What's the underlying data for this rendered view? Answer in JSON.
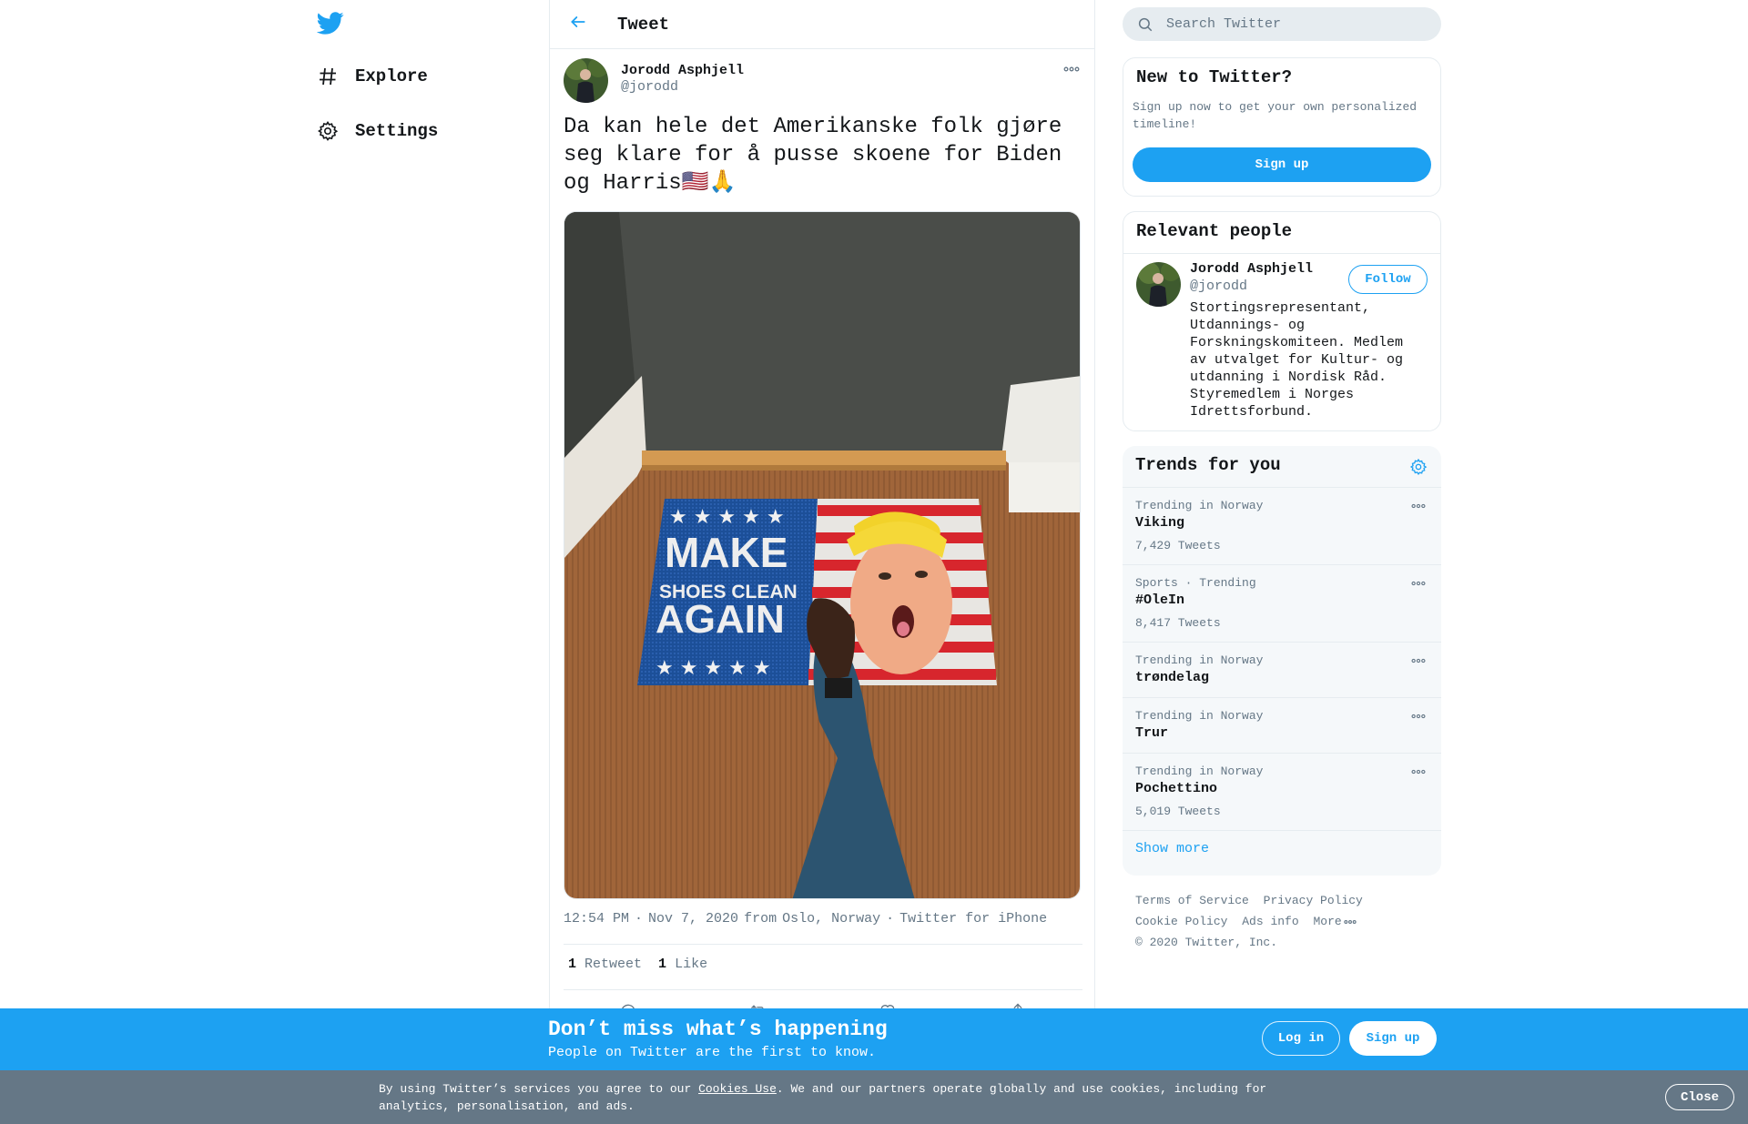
{
  "nav": {
    "logo_icon": "twitter-bird-icon",
    "items": [
      {
        "icon": "hashtag-icon",
        "label": "Explore"
      },
      {
        "icon": "gear-icon",
        "label": "Settings"
      }
    ]
  },
  "header": {
    "back_icon": "arrow-left-icon",
    "title": "Tweet"
  },
  "tweet": {
    "author_name": "Jorodd Asphjell",
    "author_handle": "@jorodd",
    "text": "Da kan hele det Amerikanske folk gjøre seg klare for å pusse skoene for Biden og Harris🇺🇸🙏",
    "media_doormat": {
      "left_top": "MAKE",
      "left_mid": "SHOES CLEAN",
      "left_bottom": "AGAIN"
    },
    "meta": {
      "time": "12:54 PM",
      "sep1": "·",
      "date": "Nov 7, 2020",
      "from_label": "from",
      "location": "Oslo, Norway",
      "sep2": "·",
      "source": "Twitter for iPhone"
    },
    "stats": {
      "retweets_count": "1",
      "retweets_label": "Retweet",
      "likes_count": "1",
      "likes_label": "Like"
    },
    "actions": [
      "reply-icon",
      "retweet-icon",
      "like-icon",
      "share-icon"
    ]
  },
  "search": {
    "placeholder": "Search Twitter"
  },
  "new_to_twitter": {
    "title": "New to Twitter?",
    "description": "Sign up now to get your own personalized timeline!",
    "button": "Sign up"
  },
  "relevant_people": {
    "title": "Relevant people",
    "person": {
      "name": "Jorodd Asphjell",
      "handle": "@jorodd",
      "bio": "Stortingsrepresentant, Utdannings- og Forskningskomiteen. Medlem av utvalget for Kultur- og utdanning i Nordisk Råd. Styremedlem i Norges Idrettsforbund.",
      "follow_label": "Follow"
    }
  },
  "trends": {
    "title": "Trends for you",
    "items": [
      {
        "context": "Trending in Norway",
        "name": "Viking",
        "count": "7,429 Tweets"
      },
      {
        "context": "Sports · Trending",
        "name": "#OleIn",
        "count": "8,417 Tweets"
      },
      {
        "context": "Trending in Norway",
        "name": "trøndelag",
        "count": ""
      },
      {
        "context": "Trending in Norway",
        "name": "Trur",
        "count": ""
      },
      {
        "context": "Trending in Norway",
        "name": "Pochettino",
        "count": "5,019 Tweets"
      }
    ],
    "show_more": "Show more"
  },
  "footer": {
    "terms": "Terms of Service",
    "privacy": "Privacy Policy",
    "cookie": "Cookie Policy",
    "ads": "Ads info",
    "more": "More",
    "copyright": "© 2020 Twitter, Inc."
  },
  "bottom_bar": {
    "title": "Don’t miss what’s happening",
    "subtitle": "People on Twitter are the first to know.",
    "login": "Log in",
    "signup": "Sign up"
  },
  "cookie_bar": {
    "text_before": "By using Twitter’s services you agree to our ",
    "link": "Cookies Use",
    "text_after": ". We and our partners operate globally and use cookies, including for analytics, personalisation, and ads.",
    "close": "Close"
  },
  "colors": {
    "accent": "#1da1f2",
    "secondary_text": "#657786",
    "border": "#e6ecf0",
    "cookie_bar": "#657786"
  }
}
